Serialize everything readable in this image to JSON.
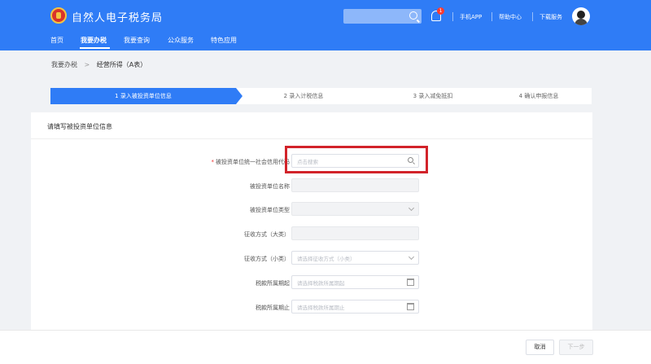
{
  "header": {
    "site_title": "自然人电子税务局",
    "notification_count": "1",
    "links": [
      "手机APP",
      "帮助中心",
      "下载服务"
    ],
    "nav": [
      "首页",
      "我要办税",
      "我要查询",
      "公众服务",
      "特色应用"
    ],
    "active_nav": "我要办税"
  },
  "breadcrumb": {
    "parent": "我要办税",
    "separator": ">",
    "current": "经营所得（A表）"
  },
  "steps": [
    "1 录入被投资单位信息",
    "2 录入计税信息",
    "3 录入减免抵扣",
    "4 确认申报信息"
  ],
  "form": {
    "title": "请填写被投资单位信息",
    "fields": [
      {
        "label": "被投资单位统一社会信用代码",
        "required": true,
        "placeholder": "点击搜索"
      },
      {
        "label": "被投资单位名称",
        "placeholder": ""
      },
      {
        "label": "被投资单位类型",
        "placeholder": ""
      },
      {
        "label": "征收方式（大类）",
        "placeholder": ""
      },
      {
        "label": "征收方式（小类）",
        "placeholder": "请选择征收方式（小类）"
      },
      {
        "label": "税款所属期起",
        "placeholder": "请选择税款所属期起"
      },
      {
        "label": "税款所属期止",
        "placeholder": "请选择税款所属期止"
      }
    ]
  },
  "footer": {
    "cancel_label": "取消",
    "next_label": "下一步"
  },
  "colors": {
    "primary": "#2f7cf6",
    "highlight": "#d2232a"
  }
}
